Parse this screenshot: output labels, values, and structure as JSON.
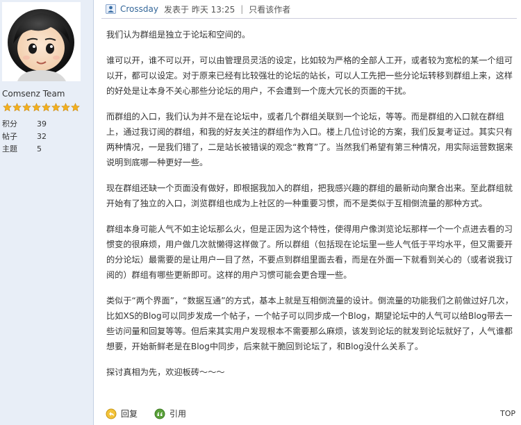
{
  "user": {
    "name": "Comsenz Team",
    "star_count": 8,
    "stats": [
      {
        "label": "积分",
        "value": "39"
      },
      {
        "label": "帖子",
        "value": "32"
      },
      {
        "label": "主题",
        "value": "5"
      }
    ]
  },
  "post": {
    "author": "Crossday",
    "posted_label": "发表于",
    "time": "昨天 13:25",
    "separator": "|",
    "only_author": "只看该作者",
    "paragraphs": [
      "我们认为群组是独立于论坛和空间的。",
      "谁可以开，谁不可以开，可以由管理员灵活的设定，比如较为严格的全部人工开，或者较为宽松的某一个组可以开，都可以设定。对于原来已经有比较强壮的论坛的站长，可以人工先把一些分论坛转移到群组上来，这样的好处是让本身不关心那些分论坛的用户，不会遭到一个庞大冗长的页面的干扰。",
      "而群组的入口，我们认为并不是在论坛中，或者几个群组关联到一个论坛，等等。而是群组的入口就在群组上，通过我订阅的群组，和我的好友关注的群组作为入口。楼上几位讨论的方案，我们反复考证过。其实只有两种情况，一是我们错了，二是站长被错误的观念“教育”了。当然我们希望有第三种情况，用实际运营数据来说明到底哪一种更好一些。",
      "现在群组还缺一个页面没有做好，即根据我加入的群组，把我感兴趣的群组的最新动向聚合出来。至此群组就开始有了独立的入口，浏览群组也成为上社区的一种重要习惯，而不是类似于互相倒流量的那种方式。",
      "群组本身可能人气不如主论坛那么火，但是正因为这个特性，使得用户像浏览论坛那样一个一个点进去看的习惯变的很麻烦，用户做几次就懒得这样做了。所以群组（包括现在论坛里一些人气低于平均水平，但又需要开的分论坛）最需要的是让用户一目了然，不要点到群组里面去看，而是在外面一下就看到关心的（或者说我订阅的）群组有哪些更新即可。这样的用户习惯可能会更合理一些。",
      "类似于“两个界面”，“数据互通”的方式，基本上就是互相倒流量的设计。倒流量的功能我们之前做过好几次，比如XS的Blog可以同步发成一个帖子，一个帖子可以同步成一个Blog，期望论坛中的人气可以给Blog带去一些访问量和回复等等。但后来其实用户发现根本不需要那么麻烦，该发到论坛的就发到论坛就好了，人气谁都想要，开始新鲜老是在Blog中同步，后来就干脆回到论坛了，和Blog没什么关系了。",
      "探讨真相为先，欢迎板砖～～～"
    ]
  },
  "actions": {
    "reply": "回复",
    "quote": "引用",
    "top": "TOP"
  },
  "colors": {
    "sidebar_bg": "#e8eef7",
    "star": "#f2b01e",
    "link": "#336699"
  },
  "icons": [
    "avatar-cartoon",
    "online-user-icon",
    "star-icon",
    "reply-icon",
    "quote-icon"
  ]
}
